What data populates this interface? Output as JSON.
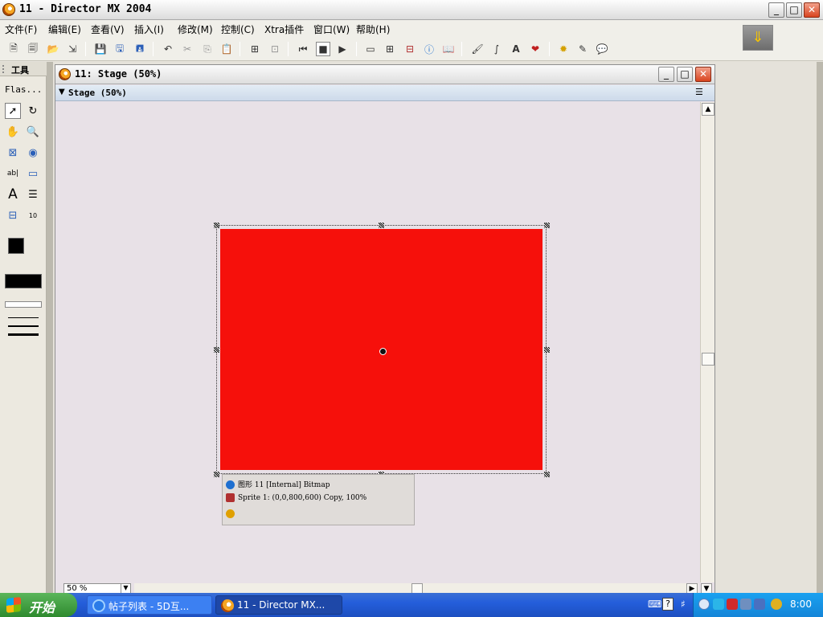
{
  "window": {
    "title": "11 - Director MX 2004",
    "minimize": "_",
    "maximize": "□",
    "close": "✕"
  },
  "menu": [
    {
      "label": "文件(F)"
    },
    {
      "label": "编辑(E)"
    },
    {
      "label": "查看(V)"
    },
    {
      "label": "插入(I)"
    },
    {
      "label": "修改(M)"
    },
    {
      "label": "控制(C)"
    },
    {
      "label": "Xtra插件"
    },
    {
      "label": "窗口(W)"
    },
    {
      "label": "帮助(H)"
    }
  ],
  "tools_panel": {
    "title": "工具",
    "mode": "Flas..."
  },
  "stage_window": {
    "title": "11: Stage (50%)",
    "panel_title": "Stage (50%)",
    "zoom": "50 %"
  },
  "sprite": {
    "fill_color": "#f6100b",
    "cast_line": "图形 11 [Internal] Bitmap",
    "sprite_line": "Sprite 1: (0,0,800,600) Copy, 100%"
  },
  "taskbar": {
    "start": "开始",
    "tasks": [
      {
        "label": "帖子列表 - 5D互..."
      },
      {
        "label": "11 - Director MX..."
      }
    ],
    "time": "8:00"
  },
  "colors": {
    "stage_bg": "#e8e1e7",
    "taskbar": "#245edb",
    "start": "#2e8a2e"
  }
}
